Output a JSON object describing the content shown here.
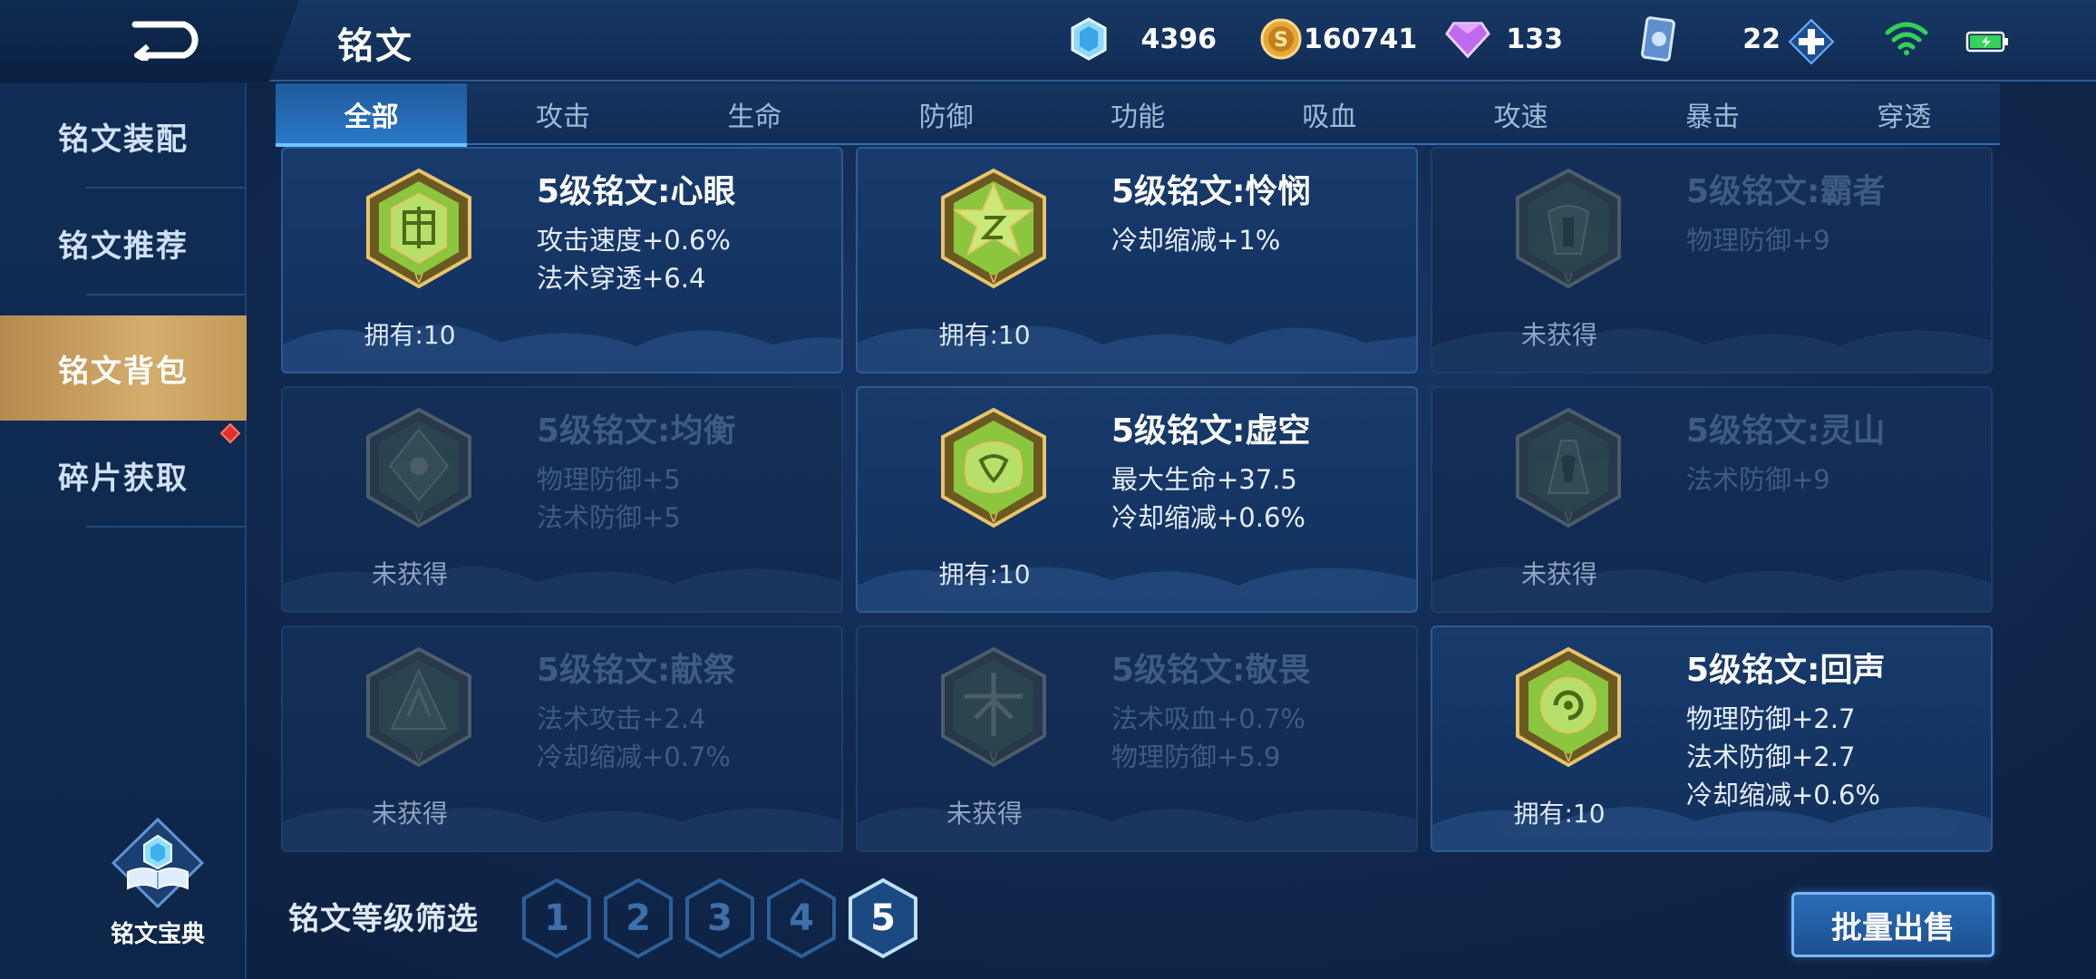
{
  "header": {
    "title": "铭文",
    "currencies": [
      {
        "icon": "diamond-crystal-icon",
        "value": "4396"
      },
      {
        "icon": "gold-coin-icon",
        "value": "160741"
      },
      {
        "icon": "purple-gem-icon",
        "value": "133"
      },
      {
        "icon": "inscription-card-icon",
        "value": "22"
      }
    ]
  },
  "sidebar": {
    "items": [
      {
        "label": "铭文装配"
      },
      {
        "label": "铭文推荐"
      },
      {
        "label": "铭文背包"
      },
      {
        "label": "碎片获取"
      }
    ],
    "active_index": 2,
    "codex_label": "铭文宝典"
  },
  "tabs": [
    "全部",
    "攻击",
    "生命",
    "防御",
    "功能",
    "吸血",
    "攻速",
    "暴击",
    "穿透"
  ],
  "active_tab": 0,
  "cards": [
    {
      "name": "5级铭文:心眼",
      "stats": [
        "攻击速度+0.6%",
        "法术穿透+6.4"
      ],
      "owned": "拥有:10",
      "locked": false
    },
    {
      "name": "5级铭文:怜悯",
      "stats": [
        "冷却缩减+1%"
      ],
      "owned": "拥有:10",
      "locked": false
    },
    {
      "name": "5级铭文:霸者",
      "stats": [
        "物理防御+9"
      ],
      "owned": "未获得",
      "locked": true
    },
    {
      "name": "5级铭文:均衡",
      "stats": [
        "物理防御+5",
        "法术防御+5"
      ],
      "owned": "未获得",
      "locked": true
    },
    {
      "name": "5级铭文:虚空",
      "stats": [
        "最大生命+37.5",
        "冷却缩减+0.6%"
      ],
      "owned": "拥有:10",
      "locked": false
    },
    {
      "name": "5级铭文:灵山",
      "stats": [
        "法术防御+9"
      ],
      "owned": "未获得",
      "locked": true
    },
    {
      "name": "5级铭文:献祭",
      "stats": [
        "法术攻击+2.4",
        "冷却缩减+0.7%"
      ],
      "owned": "未获得",
      "locked": true
    },
    {
      "name": "5级铭文:敬畏",
      "stats": [
        "法术吸血+0.7%",
        "物理防御+5.9"
      ],
      "owned": "未获得",
      "locked": true
    },
    {
      "name": "5级铭文:回声",
      "stats": [
        "物理防御+2.7",
        "法术防御+2.7",
        "冷却缩减+0.6%"
      ],
      "owned": "拥有:10",
      "locked": false
    }
  ],
  "filter": {
    "label": "铭文等级筛选",
    "levels": [
      "1",
      "2",
      "3",
      "4",
      "5"
    ],
    "selected": "5"
  },
  "sell_button": "批量出售",
  "colors": {
    "accent": "#2a79c8",
    "gold": "#d4ad6c",
    "emblem_green": "#7bc236"
  }
}
